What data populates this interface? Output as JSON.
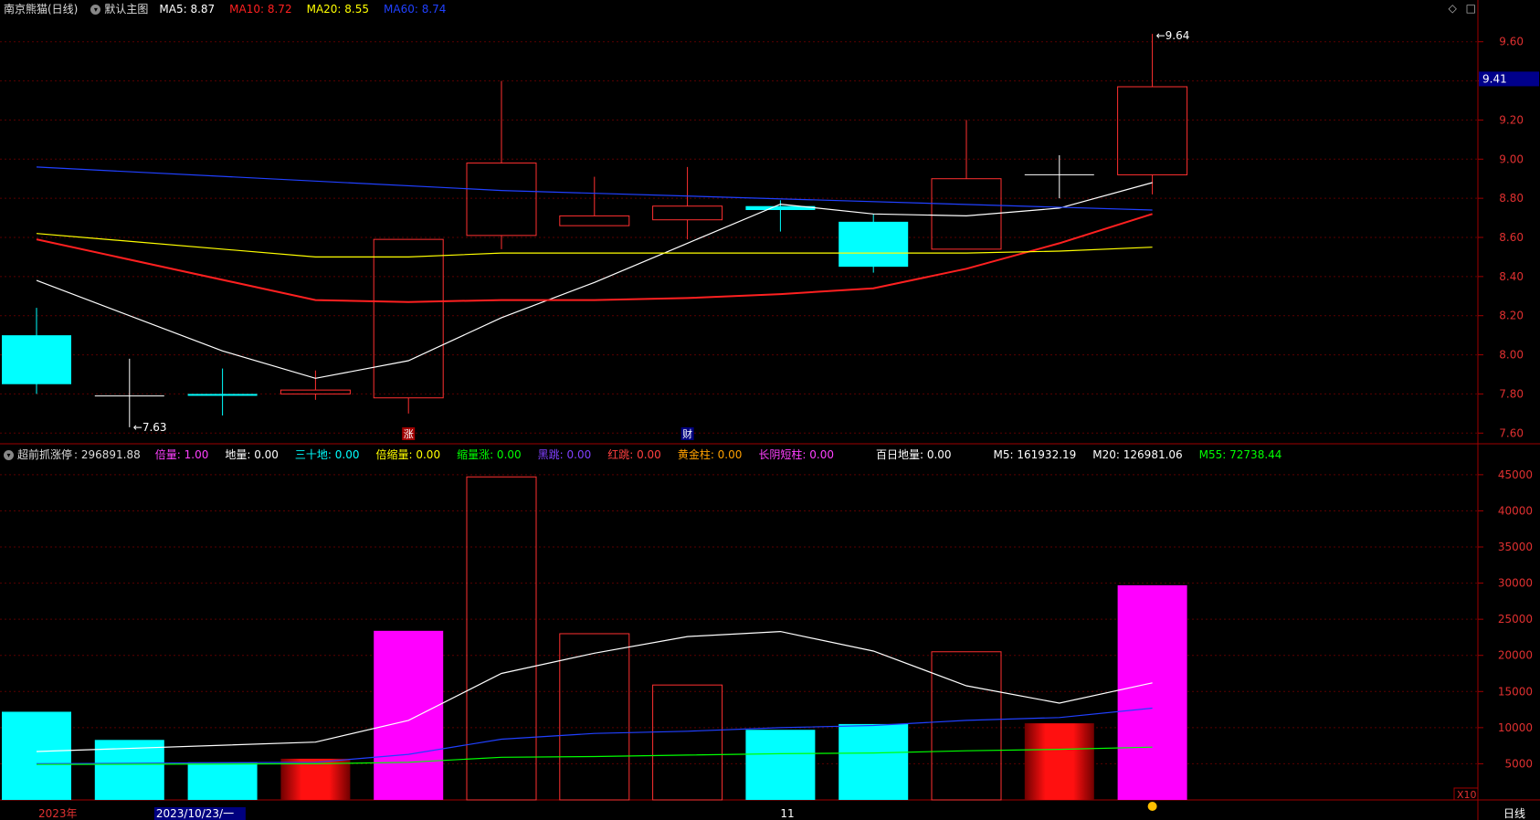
{
  "header": {
    "stock_name": "南京熊猫(日线)",
    "template": "默认主图",
    "ma": [
      {
        "label": "MA5:",
        "value": "8.87",
        "color": "#ffffff"
      },
      {
        "label": "MA10:",
        "value": "8.72",
        "color": "#ff2020"
      },
      {
        "label": "MA20:",
        "value": "8.55",
        "color": "#ffff00"
      },
      {
        "label": "MA60:",
        "value": "8.74",
        "color": "#2040ff"
      }
    ]
  },
  "vol_header": {
    "indicator": "超前抓涨停",
    "value": ": 296891.88",
    "items": [
      {
        "label": "倍量:",
        "value": "1.00",
        "color": "#ff40ff"
      },
      {
        "label": "地量:",
        "value": "0.00",
        "color": "#ffffff"
      },
      {
        "label": "三十地:",
        "value": "0.00",
        "color": "#00ffff"
      },
      {
        "label": "倍缩量:",
        "value": "0.00",
        "color": "#ffff00"
      },
      {
        "label": "缩量涨:",
        "value": "0.00",
        "color": "#00ff00"
      },
      {
        "label": "黑跳:",
        "value": "0.00",
        "color": "#8040ff"
      },
      {
        "label": "红跳:",
        "value": "0.00",
        "color": "#ff4040"
      },
      {
        "label": "黄金柱:",
        "value": "0.00",
        "color": "#ffa000"
      },
      {
        "label": "长阴短柱:",
        "value": "0.00",
        "color": "#ff40ff"
      },
      {
        "label": "百日地量:",
        "value": "0.00",
        "color": "#ffffff"
      },
      {
        "label": "M5:",
        "value": "161932.19",
        "color": "#ffffff"
      },
      {
        "label": "M20:",
        "value": "126981.06",
        "color": "#ffffff"
      },
      {
        "label": "M55:",
        "value": "72738.44",
        "color": "#00ff00"
      }
    ]
  },
  "icons": [
    "diamond-icon",
    "square-icon"
  ],
  "chart_data": [
    {
      "type": "candlestick",
      "title": "南京熊猫(日线)",
      "ylim": [
        7.55,
        9.72
      ],
      "y_ticks": [
        "9.60",
        "9.40",
        "9.20",
        "9.00",
        "8.80",
        "8.60",
        "8.40",
        "8.20",
        "8.00",
        "7.80",
        "7.60"
      ],
      "current_price_label": "9.41",
      "candles": [
        {
          "open": 7.85,
          "close": 8.1,
          "high": 8.24,
          "low": 7.8,
          "color": "cyan"
        },
        {
          "open": 7.79,
          "close": 7.79,
          "high": 7.98,
          "low": 7.63,
          "color": "white"
        },
        {
          "open": 7.8,
          "close": 7.8,
          "high": 7.93,
          "low": 7.69,
          "color": "cyan"
        },
        {
          "open": 7.8,
          "close": 7.82,
          "high": 7.92,
          "low": 7.77,
          "color": "red"
        },
        {
          "open": 7.78,
          "close": 8.59,
          "high": 8.59,
          "low": 7.7,
          "color": "red"
        },
        {
          "open": 8.61,
          "close": 8.98,
          "high": 9.4,
          "low": 8.54,
          "color": "red"
        },
        {
          "open": 8.66,
          "close": 8.71,
          "high": 8.91,
          "low": 8.66,
          "color": "red"
        },
        {
          "open": 8.69,
          "close": 8.76,
          "high": 8.96,
          "low": 8.59,
          "color": "red"
        },
        {
          "open": 8.76,
          "close": 8.74,
          "high": 8.79,
          "low": 8.63,
          "color": "cyan"
        },
        {
          "open": 8.68,
          "close": 8.45,
          "high": 8.72,
          "low": 8.42,
          "color": "cyan"
        },
        {
          "open": 8.54,
          "close": 8.9,
          "high": 9.2,
          "low": 8.54,
          "color": "red"
        },
        {
          "open": 8.92,
          "close": 8.92,
          "high": 9.02,
          "low": 8.8,
          "color": "white"
        },
        {
          "open": 8.92,
          "close": 9.37,
          "high": 9.64,
          "low": 8.82,
          "color": "red"
        }
      ],
      "annotations": [
        {
          "candle": 1,
          "text": "7.63"
        },
        {
          "candle": 12,
          "text": "9.64"
        }
      ],
      "markers": [
        {
          "candle": 4,
          "text": "涨"
        },
        {
          "candle": 7,
          "text": "财"
        }
      ],
      "series": [
        {
          "name": "MA5",
          "color": "#ffffff",
          "values": [
            8.38,
            null,
            8.02,
            7.88,
            7.97,
            8.19,
            8.37,
            8.57,
            8.77,
            8.72,
            8.71,
            8.75,
            8.88
          ]
        },
        {
          "name": "MA10",
          "color": "#ff2020",
          "values": [
            8.59,
            null,
            null,
            8.28,
            8.27,
            8.28,
            8.28,
            8.29,
            8.31,
            8.34,
            8.44,
            8.57,
            8.72
          ]
        },
        {
          "name": "MA20",
          "color": "#ffff00",
          "values": [
            8.62,
            null,
            null,
            8.5,
            8.5,
            8.52,
            8.52,
            8.52,
            8.52,
            8.52,
            8.52,
            8.53,
            8.55
          ]
        },
        {
          "name": "MA60",
          "color": "#2040ff",
          "values": [
            8.96,
            null,
            null,
            null,
            null,
            8.84,
            null,
            null,
            null,
            null,
            null,
            null,
            8.74
          ]
        }
      ]
    },
    {
      "type": "bar",
      "title": "超前抓涨停",
      "ylim": [
        0,
        46500
      ],
      "y_ticks": [
        45000,
        40000,
        35000,
        30000,
        25000,
        20000,
        15000,
        10000,
        5000
      ],
      "unit_label": "X10",
      "volumes": [
        {
          "value": 12200,
          "color": "cyan"
        },
        {
          "value": 8300,
          "color": "cyan"
        },
        {
          "value": 5200,
          "color": "cyan"
        },
        {
          "value": 5700,
          "color": "red-gradient"
        },
        {
          "value": 23400,
          "color": "magenta"
        },
        {
          "value": 44700,
          "color": "red-outline"
        },
        {
          "value": 23000,
          "color": "red-outline"
        },
        {
          "value": 15900,
          "color": "red-outline"
        },
        {
          "value": 9700,
          "color": "cyan"
        },
        {
          "value": 10500,
          "color": "cyan"
        },
        {
          "value": 20500,
          "color": "red-outline"
        },
        {
          "value": 10600,
          "color": "red-gradient"
        },
        {
          "value": 29700,
          "color": "magenta"
        }
      ],
      "series": [
        {
          "name": "M5",
          "color": "#ffffff",
          "values": [
            6700,
            null,
            null,
            8000,
            11000,
            17500,
            20300,
            22600,
            23300,
            20600,
            15800,
            13400,
            16200
          ]
        },
        {
          "name": "M20",
          "color": "#2040ff",
          "values": [
            5000,
            null,
            null,
            5200,
            6300,
            8400,
            9200,
            9500,
            10000,
            10300,
            11000,
            11400,
            12700
          ]
        },
        {
          "name": "M55",
          "color": "#00ff00",
          "values": [
            4900,
            null,
            null,
            5000,
            5200,
            5900,
            6000,
            6200,
            6400,
            6500,
            6800,
            7000,
            7300
          ]
        }
      ]
    }
  ],
  "x_axis": {
    "labels": [
      {
        "candle": 0,
        "text": "2023年"
      },
      {
        "candle": 1.6,
        "text": "2023/10/23/一"
      },
      {
        "candle": 8,
        "text": "11"
      }
    ],
    "period": "日线"
  }
}
